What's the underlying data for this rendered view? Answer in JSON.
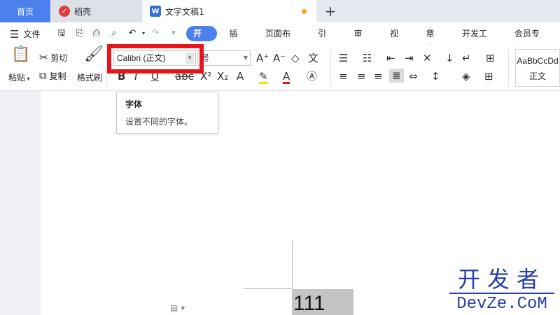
{
  "tabs": [
    {
      "label": "首页"
    },
    {
      "label": "稻壳"
    },
    {
      "label": "文字文稿1"
    }
  ],
  "tab_add_icon": "plus-icon",
  "menubar": {
    "file_label": "文件",
    "tabs": [
      "开始",
      "插入",
      "页面布局",
      "引用",
      "审阅",
      "视图",
      "章节",
      "开发工具",
      "会员专享"
    ],
    "active_tab": "开始"
  },
  "ribbon": {
    "paste_label": "粘贴",
    "cut_label": "剪切",
    "copy_label": "复制",
    "format_painter_label": "格式刷",
    "font_name": "Calibri (正文)",
    "font_size_placeholder": "号",
    "style_sample": "AaBbCcDd",
    "style_label": "正文"
  },
  "tooltip": {
    "title": "字体",
    "desc": "设置不同的字体。"
  },
  "document": {
    "selected_text": "111"
  },
  "watermark": {
    "cn": "开发者",
    "en": "DevZe.CoM"
  },
  "colors": {
    "accent": "#4c80ec",
    "highlight_box": "#e8141c",
    "selection": "#c4c4c4"
  }
}
